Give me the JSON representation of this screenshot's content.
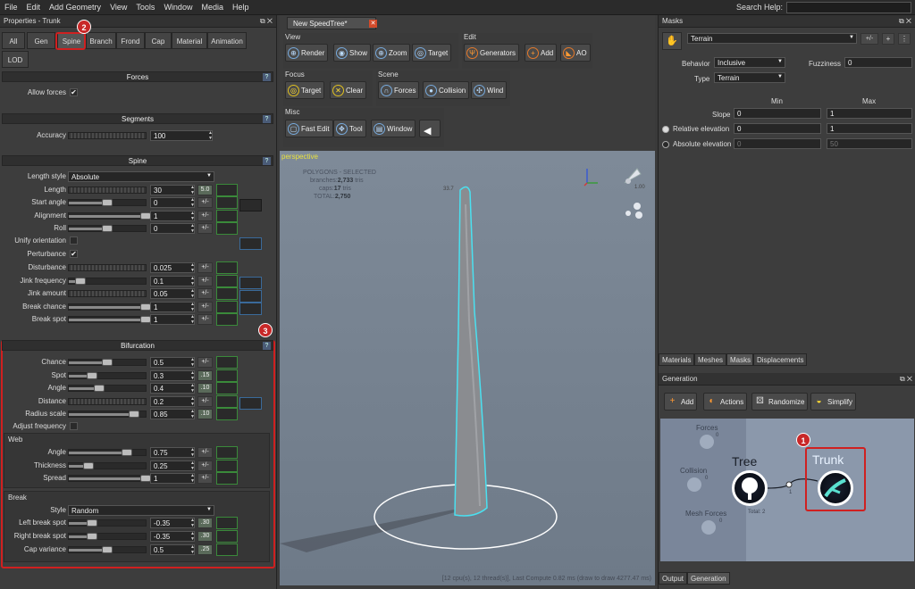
{
  "menubar": {
    "items": [
      "File",
      "Edit",
      "Add Geometry",
      "View",
      "Tools",
      "Window",
      "Media",
      "Help"
    ],
    "search_label": "Search Help:"
  },
  "left_panel": {
    "title": "Properties - Trunk",
    "tabs": [
      "All",
      "Gen",
      "Spine",
      "Branch",
      "Frond",
      "Cap",
      "Material",
      "Animation",
      "LOD"
    ],
    "active_tab": "Spine",
    "forces": {
      "title": "Forces",
      "allow_forces_label": "Allow forces",
      "allow_forces": "✔"
    },
    "segments": {
      "title": "Segments",
      "accuracy_label": "Accuracy",
      "accuracy_value": "100"
    },
    "spine": {
      "title": "Spine",
      "length_style_label": "Length style",
      "length_style_value": "Absolute",
      "rows": [
        {
          "label": "Length",
          "value": "30",
          "btn": "5.0",
          "fill": 0.0,
          "type": "grad"
        },
        {
          "label": "Start angle",
          "value": "0",
          "btn": "+/-",
          "fill": 0.5,
          "type": "slider"
        },
        {
          "label": "Alignment",
          "value": "1",
          "btn": "+/-",
          "fill": 1.0,
          "type": "slider"
        },
        {
          "label": "Roll",
          "value": "0",
          "btn": "+/-",
          "fill": 0.5,
          "type": "slider"
        }
      ],
      "unify_label": "Unify orientation",
      "perturbance_label": "Perturbance",
      "perturbance_check": "✔",
      "rows2": [
        {
          "label": "Disturbance",
          "value": "0.025",
          "btn": "+/-",
          "type": "grad"
        },
        {
          "label": "Jink frequency",
          "value": "0.1",
          "btn": "+/-",
          "fill": 0.15,
          "type": "slider"
        },
        {
          "label": "Jink amount",
          "value": "0.05",
          "btn": "+/-",
          "type": "grad"
        },
        {
          "label": "Break chance",
          "value": "1",
          "btn": "+/-",
          "fill": 1.0,
          "type": "slider"
        },
        {
          "label": "Break spot",
          "value": "1",
          "btn": "+/-",
          "fill": 1.0,
          "type": "slider"
        }
      ]
    },
    "bifurcation": {
      "title": "Bifurcation",
      "rows": [
        {
          "label": "Chance",
          "value": "0.5",
          "btn": "+/-",
          "fill": 0.5,
          "type": "slider"
        },
        {
          "label": "Spot",
          "value": "0.3",
          "btn": ".15",
          "fill": 0.3,
          "type": "slider"
        },
        {
          "label": "Angle",
          "value": "0.4",
          "btn": ".10",
          "fill": 0.4,
          "type": "slider"
        },
        {
          "label": "Distance",
          "value": "0.2",
          "btn": "+/-",
          "type": "grad"
        },
        {
          "label": "Radius scale",
          "value": "0.85",
          "btn": ".10",
          "fill": 0.85,
          "type": "slider"
        }
      ],
      "adjust_label": "Adjust frequency",
      "web_title": "Web",
      "web_rows": [
        {
          "label": "Angle",
          "value": "0.75",
          "btn": "+/-",
          "fill": 0.75,
          "type": "slider"
        },
        {
          "label": "Thickness",
          "value": "0.25",
          "btn": "+/-",
          "fill": 0.25,
          "type": "slider"
        },
        {
          "label": "Spread",
          "value": "1",
          "btn": "+/-",
          "fill": 1.0,
          "type": "slider"
        }
      ],
      "break_title": "Break",
      "style_label": "Style",
      "style_value": "Random",
      "break_rows": [
        {
          "label": "Left break spot",
          "value": "-0.35",
          "btn": ".30",
          "fill": 0.3,
          "type": "slider"
        },
        {
          "label": "Right break spot",
          "value": "-0.35",
          "btn": ".30",
          "fill": 0.3,
          "type": "slider"
        },
        {
          "label": "Cap variance",
          "value": "0.5",
          "btn": ".25",
          "fill": 0.5,
          "type": "slider"
        }
      ]
    }
  },
  "badges": {
    "one": "1",
    "two": "2",
    "three": "3"
  },
  "center": {
    "doc_tab": "New SpeedTree*",
    "doc_close": "✕",
    "view_group": {
      "title": "View",
      "buttons": [
        "Render",
        "Show",
        "Zoom",
        "Target"
      ]
    },
    "edit_group": {
      "title": "Edit",
      "buttons": [
        "Generators",
        "Add",
        "AO"
      ]
    },
    "focus_group": {
      "title": "Focus",
      "buttons": [
        "Target",
        "Clear"
      ]
    },
    "scene_group": {
      "title": "Scene",
      "buttons": [
        "Forces",
        "Collision",
        "Wind"
      ]
    },
    "misc_group": {
      "title": "Misc",
      "buttons": [
        "Fast Edit",
        "Tool",
        "Window"
      ]
    },
    "viewport": {
      "mode": "perspective",
      "stats_title": "POLYGONS - SELECTED",
      "branches_label": "branches:",
      "branches_value": "2,733",
      "branches_unit": "tris",
      "caps_label": "caps:",
      "caps_value": "17",
      "caps_unit": "tris",
      "total_label": "TOTAL:",
      "total_value": "2,750",
      "ruler_label": "33.7",
      "light_label": "1.00",
      "footer": "[12 cpu(s), 12 thread(s)], Last Compute 0.82 ms (draw to draw 4277.47 ms)"
    }
  },
  "right": {
    "masks": {
      "title": "Masks",
      "terrain": "Terrain",
      "plusminus": "+/-",
      "behavior_label": "Behavior",
      "behavior_value": "Inclusive",
      "fuzziness_label": "Fuzziness",
      "fuzziness_value": "0",
      "type_label": "Type",
      "type_value": "Terrain",
      "min_label": "Min",
      "max_label": "Max",
      "slope_label": "Slope",
      "slope_min": "0",
      "slope_max": "1",
      "rel_label": "Relative elevation",
      "rel_min": "0",
      "rel_max": "1",
      "abs_label": "Absolute elevation",
      "abs_min": "0",
      "abs_max": "50"
    },
    "bottom_tabs": [
      "Materials",
      "Meshes",
      "Masks",
      "Displacements"
    ],
    "generation": {
      "title": "Generation",
      "buttons": [
        "Add",
        "Actions",
        "Randomize",
        "Simplify"
      ],
      "forces_label": "Forces",
      "collision_label": "Collision",
      "mesh_forces_label": "Mesh Forces",
      "tree_label": "Tree",
      "trunk_label": "Trunk",
      "total_label": "Total: 2",
      "link_label": "1",
      "node_count": "0"
    },
    "output_tabs": [
      "Output",
      "Generation"
    ]
  }
}
